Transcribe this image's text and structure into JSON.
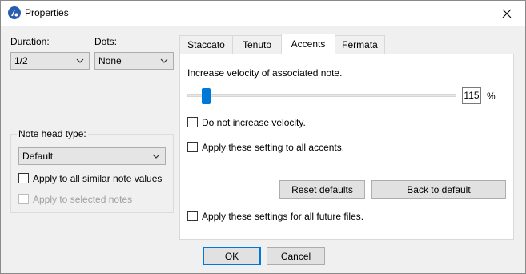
{
  "window": {
    "title": "Properties",
    "close_label": "✕"
  },
  "left": {
    "duration_label": "Duration:",
    "duration_value": "1/2",
    "dots_label": "Dots:",
    "dots_value": "None",
    "notehead_label": "Note head type:",
    "notehead_value": "Default",
    "apply_similar_label": "Apply to all similar note values",
    "apply_selected_label": "Apply to selected notes"
  },
  "tabs": [
    {
      "label": "Staccato"
    },
    {
      "label": "Tenuto"
    },
    {
      "label": "Accents"
    },
    {
      "label": "Fermata"
    }
  ],
  "accents": {
    "increase_label": "Increase velocity of associated note.",
    "velocity_value": "115",
    "velocity_level": 0.15,
    "percent_label": "%",
    "no_increase_label": "Do not increase velocity.",
    "apply_all_accents_label": "Apply these setting to all accents.",
    "reset_defaults_label": "Reset defaults",
    "back_to_default_label": "Back to default",
    "future_files_label": "Apply these settings for all future files."
  },
  "footer": {
    "ok_label": "OK",
    "cancel_label": "Cancel"
  }
}
